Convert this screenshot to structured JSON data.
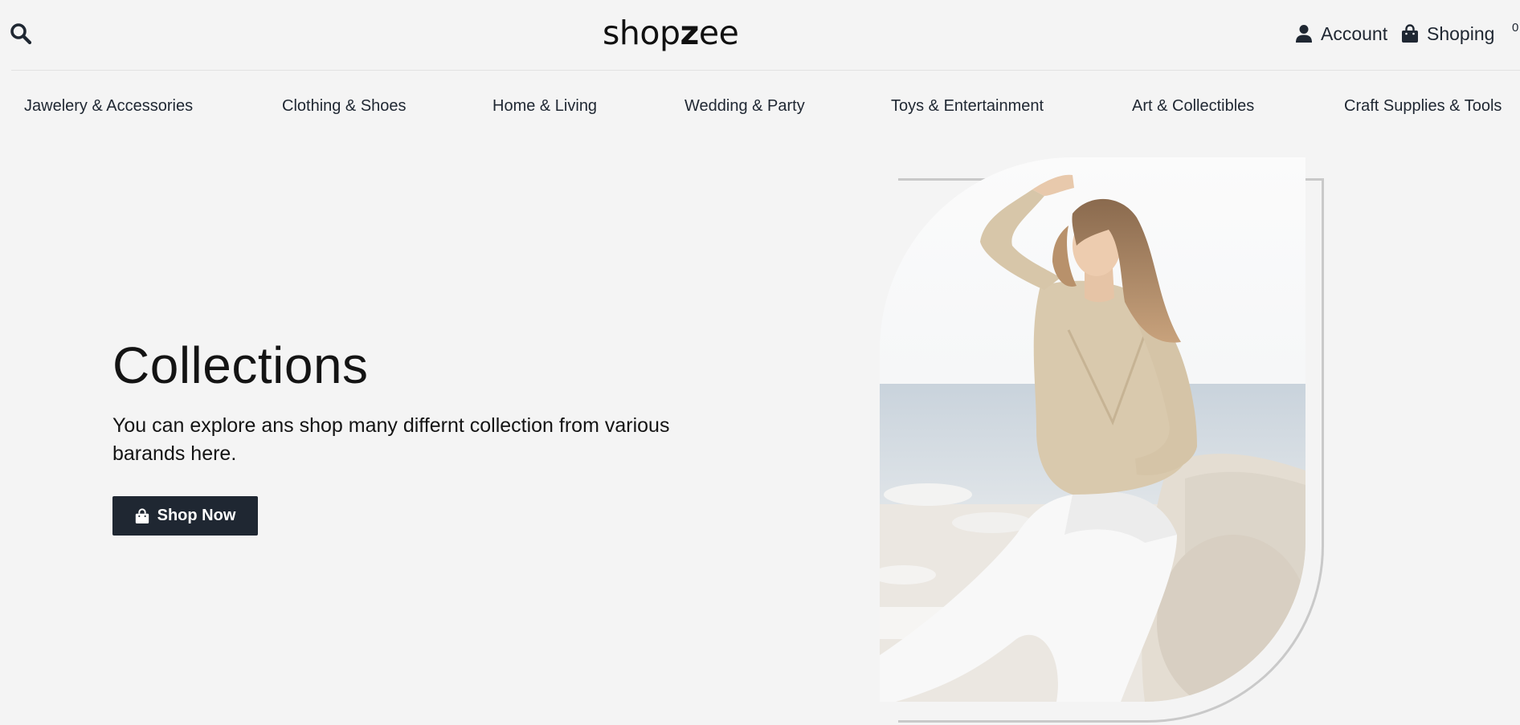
{
  "header": {
    "logo_prefix": "sh",
    "logo_o": "o",
    "logo_p": "p",
    "logo_z": "z",
    "logo_suffix": "ee",
    "account_label": "Account",
    "cart_label": "Shoping",
    "cart_count": "0"
  },
  "categories": [
    "Jawelery & Accessories",
    "Clothing & Shoes",
    "Home & Living",
    "Wedding & Party",
    "Toys & Entertainment",
    "Art & Collectibles",
    "Craft Supplies & Tools"
  ],
  "hero": {
    "title": "Collections",
    "text": "You can explore ans shop many differnt collection from various barands here.",
    "button_label": "Shop Now"
  },
  "icons": {
    "search": "search-icon",
    "account": "user-icon",
    "cart": "shopping-bag-icon",
    "button": "shopping-bag-icon"
  },
  "colors": {
    "background": "#f4f4f4",
    "primary": "#1f2732",
    "text": "#141414"
  }
}
